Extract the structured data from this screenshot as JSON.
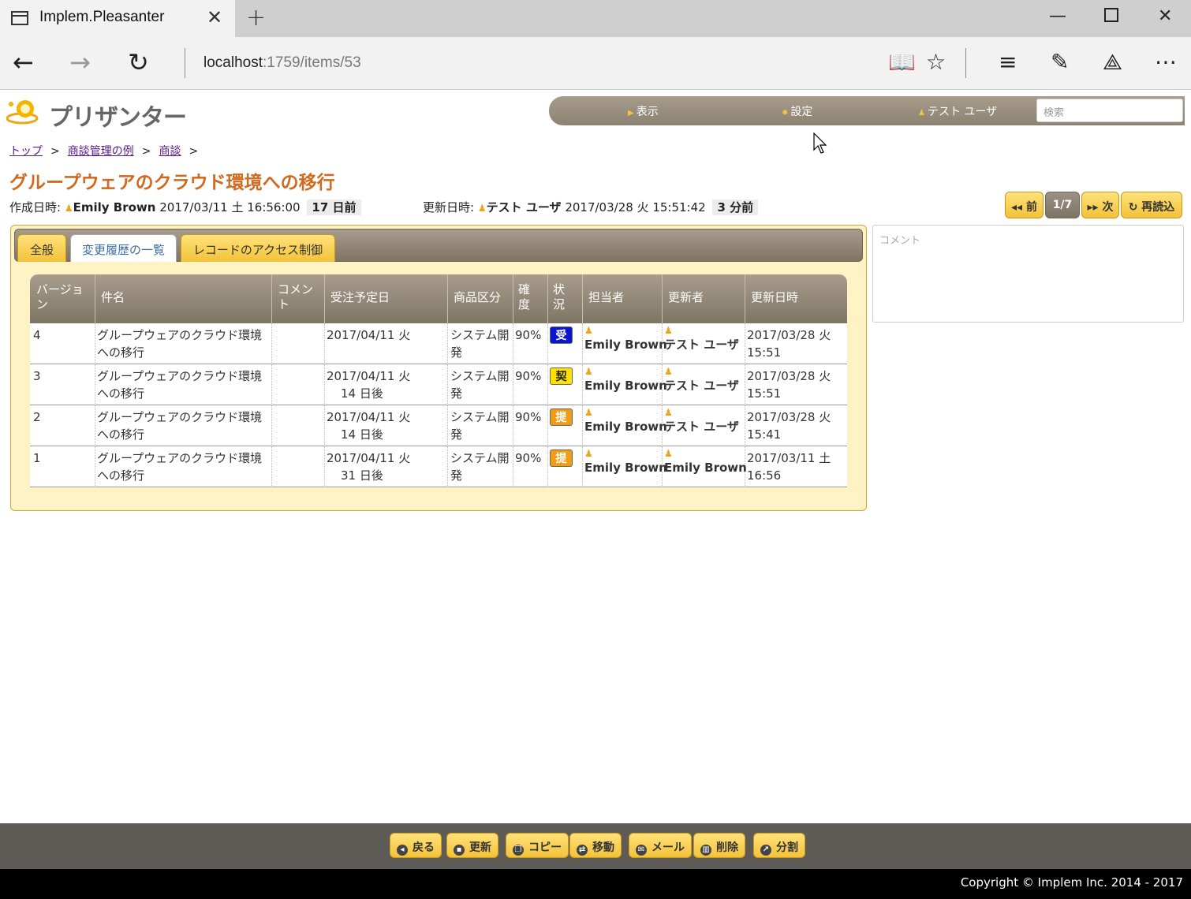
{
  "browser": {
    "tab_title": "Implem.Pleasanter",
    "url_host": "localhost",
    "url_path": ":1759/items/53"
  },
  "header": {
    "logo_text": "プリザンター",
    "nav": [
      {
        "label": "表示"
      },
      {
        "label": "設定"
      },
      {
        "label": "テスト ユーザ"
      }
    ],
    "search_placeholder": "検索"
  },
  "breadcrumb": [
    {
      "label": "トップ"
    },
    {
      "label": "商談管理の例"
    },
    {
      "label": "商談"
    }
  ],
  "breadcrumb_sep": ">",
  "page_title": "グループウェアのクラウド環境への移行",
  "meta": {
    "created_label": "作成日時:",
    "created_user": "Emily Brown",
    "created_at": "2017/03/11 土 16:56:00",
    "created_ago": "17 日前",
    "updated_label": "更新日時:",
    "updated_user": "テスト ユーザ",
    "updated_at": "2017/03/28 火 15:51:42",
    "updated_ago": "3 分前"
  },
  "record_nav": {
    "prev": "前",
    "page": "1/7",
    "next": "次",
    "reload": "再読込"
  },
  "editor_tabs": [
    {
      "label": "全般"
    },
    {
      "label": "変更履歴の一覧"
    },
    {
      "label": "レコードのアクセス制御"
    }
  ],
  "grid": {
    "columns": [
      {
        "label": "バージョン"
      },
      {
        "label": "件名"
      },
      {
        "label": "コメント"
      },
      {
        "label": "受注予定日"
      },
      {
        "label": "商品区分"
      },
      {
        "label": "確度"
      },
      {
        "label": "状況"
      },
      {
        "label": "担当者"
      },
      {
        "label": "更新者"
      },
      {
        "label": "更新日時"
      }
    ],
    "rows": [
      {
        "version": "4",
        "title_1": "グループウェアのクラウド環境",
        "title_2": "への移行",
        "date": "2017/04/11 火",
        "remain": "",
        "category_1": "システム開",
        "category_2": "発",
        "prob": "90%",
        "status": "受",
        "owner": "Emily Brown",
        "updater": "テスト ユーザ",
        "updated_1": "2017/03/28 火",
        "updated_2": "15:51"
      },
      {
        "version": "3",
        "title_1": "グループウェアのクラウド環境",
        "title_2": "への移行",
        "date": "2017/04/11 火",
        "remain": "14 日後",
        "category_1": "システム開",
        "category_2": "発",
        "prob": "90%",
        "status": "契",
        "owner": "Emily Brown",
        "updater": "テスト ユーザ",
        "updated_1": "2017/03/28 火",
        "updated_2": "15:51"
      },
      {
        "version": "2",
        "title_1": "グループウェアのクラウド環境",
        "title_2": "への移行",
        "date": "2017/04/11 火",
        "remain": "14 日後",
        "category_1": "システム開",
        "category_2": "発",
        "prob": "90%",
        "status": "提",
        "owner": "Emily Brown",
        "updater": "テスト ユーザ",
        "updated_1": "2017/03/28 火",
        "updated_2": "15:41"
      },
      {
        "version": "1",
        "title_1": "グループウェアのクラウド環境",
        "title_2": "への移行",
        "date": "2017/04/11 火",
        "remain": "31 日後",
        "category_1": "システム開",
        "category_2": "発",
        "prob": "90%",
        "status": "提",
        "owner": "Emily Brown",
        "updater": "Emily Brown",
        "updated_1": "2017/03/11 土",
        "updated_2": "16:56"
      }
    ]
  },
  "comment_placeholder": "コメント",
  "commands": [
    {
      "label": "戻る"
    },
    {
      "label": "更新"
    },
    {
      "label": "コピー"
    },
    {
      "label": "移動"
    },
    {
      "label": "メール"
    },
    {
      "label": "削除"
    },
    {
      "label": "分割"
    }
  ],
  "copyright": "Copyright © Implem Inc. 2014 - 2017",
  "colors": {
    "accent_title": "#d2691e",
    "button_yellow": "#f3c23a",
    "header_brown": "#8c8272",
    "status_blue": "#0a14d2",
    "status_yellow": "#ffe000",
    "status_orange": "#f39c12"
  }
}
